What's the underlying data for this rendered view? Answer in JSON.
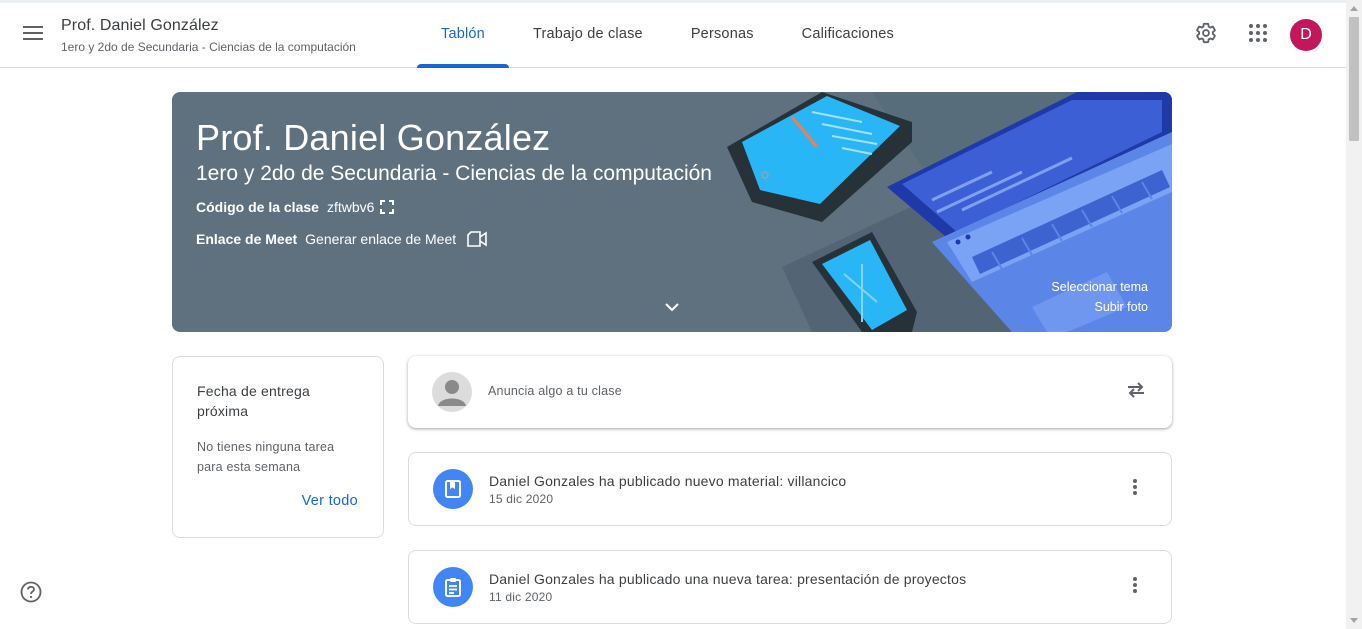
{
  "header": {
    "class_title": "Prof. Daniel González",
    "class_subtitle": "1ero y 2do de Secundaria - Ciencias de la computación",
    "menu_icon": "hamburger-menu-icon",
    "tabs": [
      {
        "label": "Tablón",
        "active": true
      },
      {
        "label": "Trabajo de clase",
        "active": false
      },
      {
        "label": "Personas",
        "active": false
      },
      {
        "label": "Calificaciones",
        "active": false
      }
    ],
    "settings_icon": "gear-icon",
    "apps_icon": "apps-grid-icon",
    "avatar_initial": "D",
    "avatar_color": "#c2185b",
    "accent_color": "#1967d2"
  },
  "banner": {
    "title": "Prof. Daniel González",
    "subtitle": "1ero y 2do de Secundaria - Ciencias de la computación",
    "class_code_label": "Código de la clase",
    "class_code": "zftwbv6",
    "meet_label": "Enlace de Meet",
    "meet_action": "Generar enlace de Meet",
    "select_theme": "Seleccionar tema",
    "upload_photo": "Subir foto",
    "background_color": "#5f717e"
  },
  "upcoming": {
    "title": "Fecha de entrega próxima",
    "empty_text": "No tienes ninguna tarea para esta semana",
    "view_all": "Ver todo"
  },
  "announce": {
    "placeholder": "Anuncia algo a tu clase",
    "repost_icon": "repost-icon"
  },
  "posts": [
    {
      "title": "Daniel Gonzales ha publicado nuevo material: villancico",
      "date": "15 dic 2020",
      "icon": "material-book-icon"
    },
    {
      "title": "Daniel Gonzales ha publicado una nueva tarea: presentación de proyectos",
      "date": "11 dic 2020",
      "icon": "assignment-icon"
    }
  ],
  "help_icon": "help-circle-icon"
}
